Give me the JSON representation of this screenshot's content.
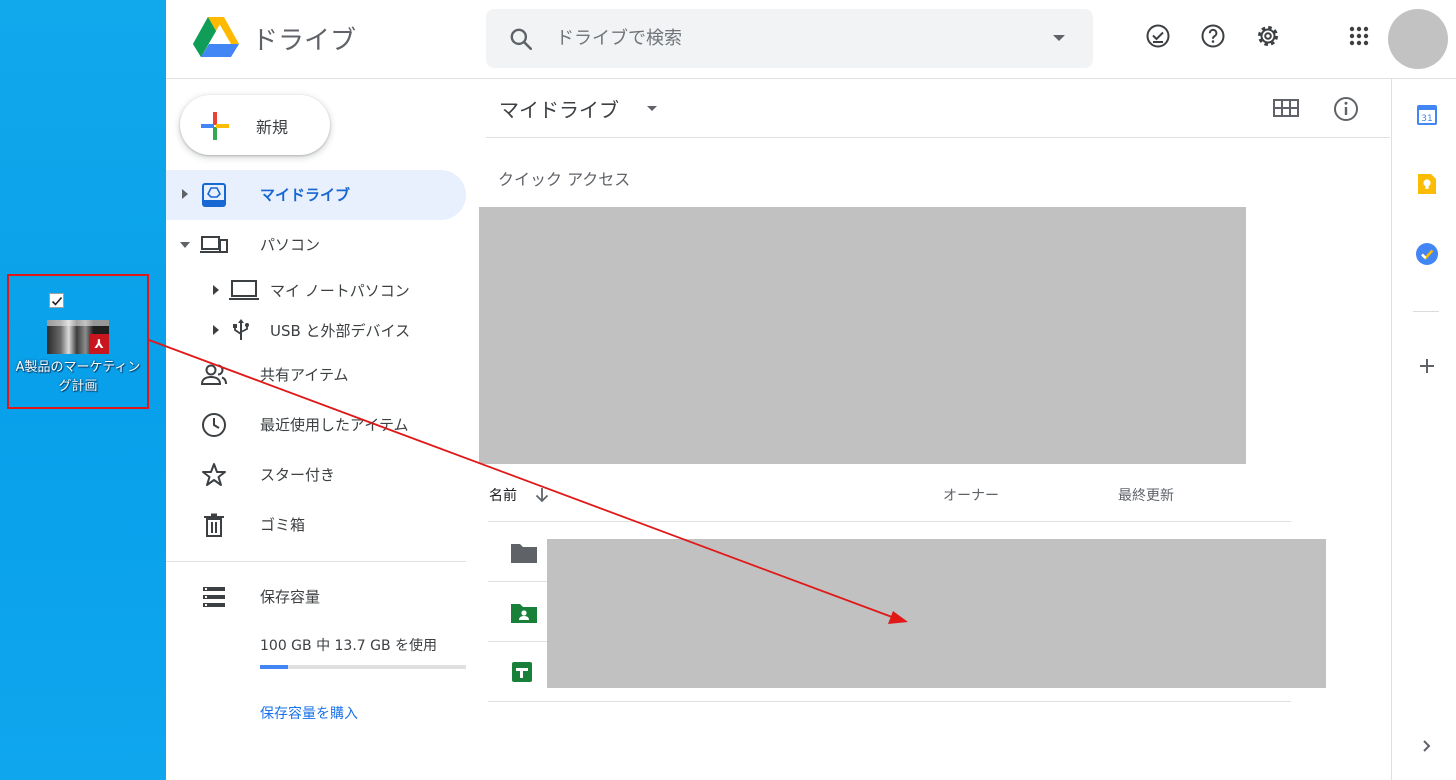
{
  "desktop": {
    "file_label": "A製品のマーケティング計画",
    "file_checked": true,
    "thumbnail_badge": "⅄"
  },
  "header": {
    "app_title": "ドライブ",
    "search_placeholder": "ドライブで検索",
    "icons": [
      "offline-check-icon",
      "help-icon",
      "settings-icon",
      "apps-grid-icon",
      "account-avatar"
    ]
  },
  "sidebar": {
    "new_label": "新規",
    "items": [
      {
        "label": "マイドライブ",
        "icon": "my-drive-icon",
        "active": true
      },
      {
        "label": "パソコン",
        "icon": "computers-icon",
        "expanded": true
      },
      {
        "label": "マイ ノートパソコン",
        "icon": "laptop-icon"
      },
      {
        "label": "USB と外部デバイス",
        "icon": "usb-icon"
      },
      {
        "label": "共有アイテム",
        "icon": "shared-icon"
      },
      {
        "label": "最近使用したアイテム",
        "icon": "recent-icon"
      },
      {
        "label": "スター付き",
        "icon": "star-icon"
      },
      {
        "label": "ゴミ箱",
        "icon": "trash-icon"
      }
    ],
    "storage": {
      "label": "保存容量",
      "usage_text": "100 GB 中 13.7 GB を使用",
      "used_fraction": 0.137,
      "buy_label": "保存容量を購入"
    }
  },
  "main": {
    "title": "マイドライブ",
    "quick_access_label": "クイック アクセス",
    "columns": {
      "name": "名前",
      "owner": "オーナー",
      "modified": "最終更新"
    },
    "row_icons": [
      "folder-icon",
      "shared-folder-icon",
      "google-sheets-icon"
    ]
  },
  "side_panel": {
    "icons": [
      "calendar-icon",
      "keep-icon",
      "tasks-icon",
      "add-icon",
      "expand-panel-icon"
    ],
    "calendar_day": "31"
  },
  "colors": {
    "desktop_bg": "#0aa3eb",
    "annotation_red": "#e01818",
    "drive_blue": "#1967d2",
    "redaction_gray": "#c1c1c1"
  }
}
